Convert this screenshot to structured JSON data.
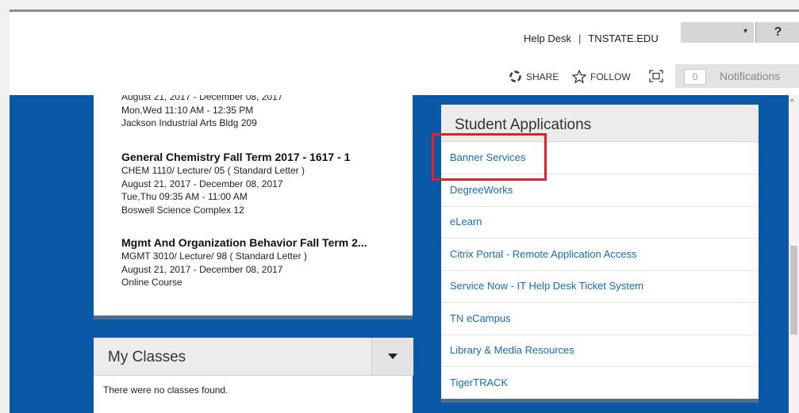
{
  "header": {
    "help_desk": "Help Desk",
    "separator": "|",
    "site_link": "TNSTATE.EDU",
    "help_button": "?",
    "user_menu_caret": "▾"
  },
  "actions": {
    "share": "SHARE",
    "follow": "FOLLOW",
    "notifications_count": "0",
    "notifications_label": "Notifications"
  },
  "courses": [
    {
      "title": "",
      "lines": [
        "August 21, 2017 - December 08, 2017",
        "Mon,Wed 11:10 AM - 12:35 PM",
        "Jackson Industrial Arts Bldg 209"
      ]
    },
    {
      "title": "General Chemistry Fall Term 2017 - 1617 - 1",
      "lines": [
        "CHEM 1110/ Lecture/ 05 ( Standard Letter )",
        "August 21, 2017 - December 08, 2017",
        "Tue,Thu 09:35 AM - 11:00 AM",
        "Boswell Science Complex 12"
      ]
    },
    {
      "title": "Mgmt And Organization Behavior Fall Term 2...",
      "lines": [
        "MGMT 3010/ Lecture/ 98 ( Standard Letter )",
        "August 21, 2017 - December 08, 2017",
        "Online Course"
      ]
    }
  ],
  "my_classes": {
    "title": "My Classes",
    "empty_message": "There were no classes found."
  },
  "student_applications": {
    "title": "Student Applications",
    "items": [
      "Banner Services",
      "DegreeWorks",
      "eLearn",
      "Citrix Portal - Remote Application Access",
      "Service Now - IT Help Desk Ticket System",
      "TN eCampus",
      "Library & Media Resources",
      "TigerTRACK"
    ]
  },
  "colors": {
    "page_blue": "#0b59a6",
    "link_blue": "#1a6ab5",
    "highlight_red": "#e0232a",
    "panel_header_gray": "#ececec"
  },
  "icons": [
    "share-icon",
    "star-icon",
    "fullscreen-icon",
    "chevron-down-icon",
    "scroll-up-arrow-icon"
  ]
}
